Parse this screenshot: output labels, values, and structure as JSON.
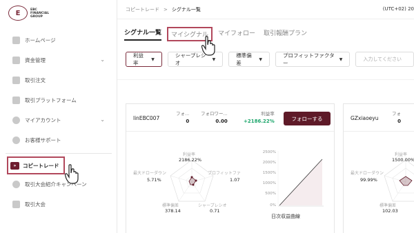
{
  "logo": {
    "line1": "EBC",
    "line2": "FINANCIAL",
    "line3": "GROUP"
  },
  "sidebar": {
    "items": [
      {
        "label": "ホームページ",
        "icon": "home-icon"
      },
      {
        "label": "資金管理",
        "icon": "wallet-icon",
        "chevron": true
      },
      {
        "label": "取引注文",
        "icon": "order-icon"
      },
      {
        "label": "取引プラットフォーム",
        "icon": "platform-icon"
      },
      {
        "label": "マイアカウント",
        "icon": "account-icon",
        "chevron": true
      },
      {
        "label": "お客様サポート",
        "icon": "support-icon"
      }
    ],
    "active": {
      "label": "コピートレード",
      "icon": "copy-trade-icon",
      "icon_text": "»"
    },
    "bottom_items": [
      {
        "label": "取引大会紹介キャンペーン",
        "icon": "referral-icon"
      },
      {
        "label": "取引大会",
        "icon": "trophy-icon"
      }
    ]
  },
  "topbar": {
    "crumb1": "コピートレード",
    "separator": ">",
    "crumb2": "シグナル一覧",
    "timezone": "(UTC+02) 20"
  },
  "tabs": [
    {
      "label": "シグナル一覧",
      "state": "active"
    },
    {
      "label": "マイシグナル",
      "state": "highlight"
    },
    {
      "label": "マイフォロー",
      "state": "normal"
    },
    {
      "label": "取引報酬プラン",
      "state": "normal"
    }
  ],
  "filters": [
    {
      "label": "利益率",
      "selected": true
    },
    {
      "label": "シャープレシオ"
    },
    {
      "label": "標準偏差"
    },
    {
      "label": "プロフィットファクター"
    }
  ],
  "search": {
    "placeholder": "入力してください"
  },
  "card1": {
    "trader": "linEBC007",
    "stat1_label": "フォ...",
    "stat1_value": "0",
    "stat2_label": "フォロワー...",
    "stat2_value": "0.00",
    "stat3_label": "利益率",
    "stat3_value": "+2186.22%",
    "follow_label": "フォローする",
    "radar": {
      "profit_label": "利益率",
      "profit_value": "2186.22%",
      "drawdown_label": "最大ドローダウン",
      "drawdown_value": "5.71%",
      "pf_label": "プロフィットファ",
      "pf_value": "1.07",
      "std_label": "標準偏差",
      "std_value": "378.14",
      "sharpe_label": "シャープレシオ",
      "sharpe_value": "0.71"
    },
    "curve_title": "日次収益曲線",
    "y_ticks": [
      "2500%",
      "2000%",
      "1500%",
      "1000%",
      "500%",
      "0%"
    ]
  },
  "card2": {
    "trader": "GZxiaoeyu",
    "stat1_label": "フォ",
    "stat1_value": "0",
    "radar": {
      "profit_label": "利益率",
      "profit_value": "1500.00%",
      "drawdown_label": "最大ドローダウン",
      "drawdown_value": "99.99%",
      "std_label": "標準偏差",
      "std_value": "102.03"
    }
  },
  "colors": {
    "brand": "#5e1a28",
    "highlight": "#b1475b",
    "positive": "#1aa56a"
  }
}
